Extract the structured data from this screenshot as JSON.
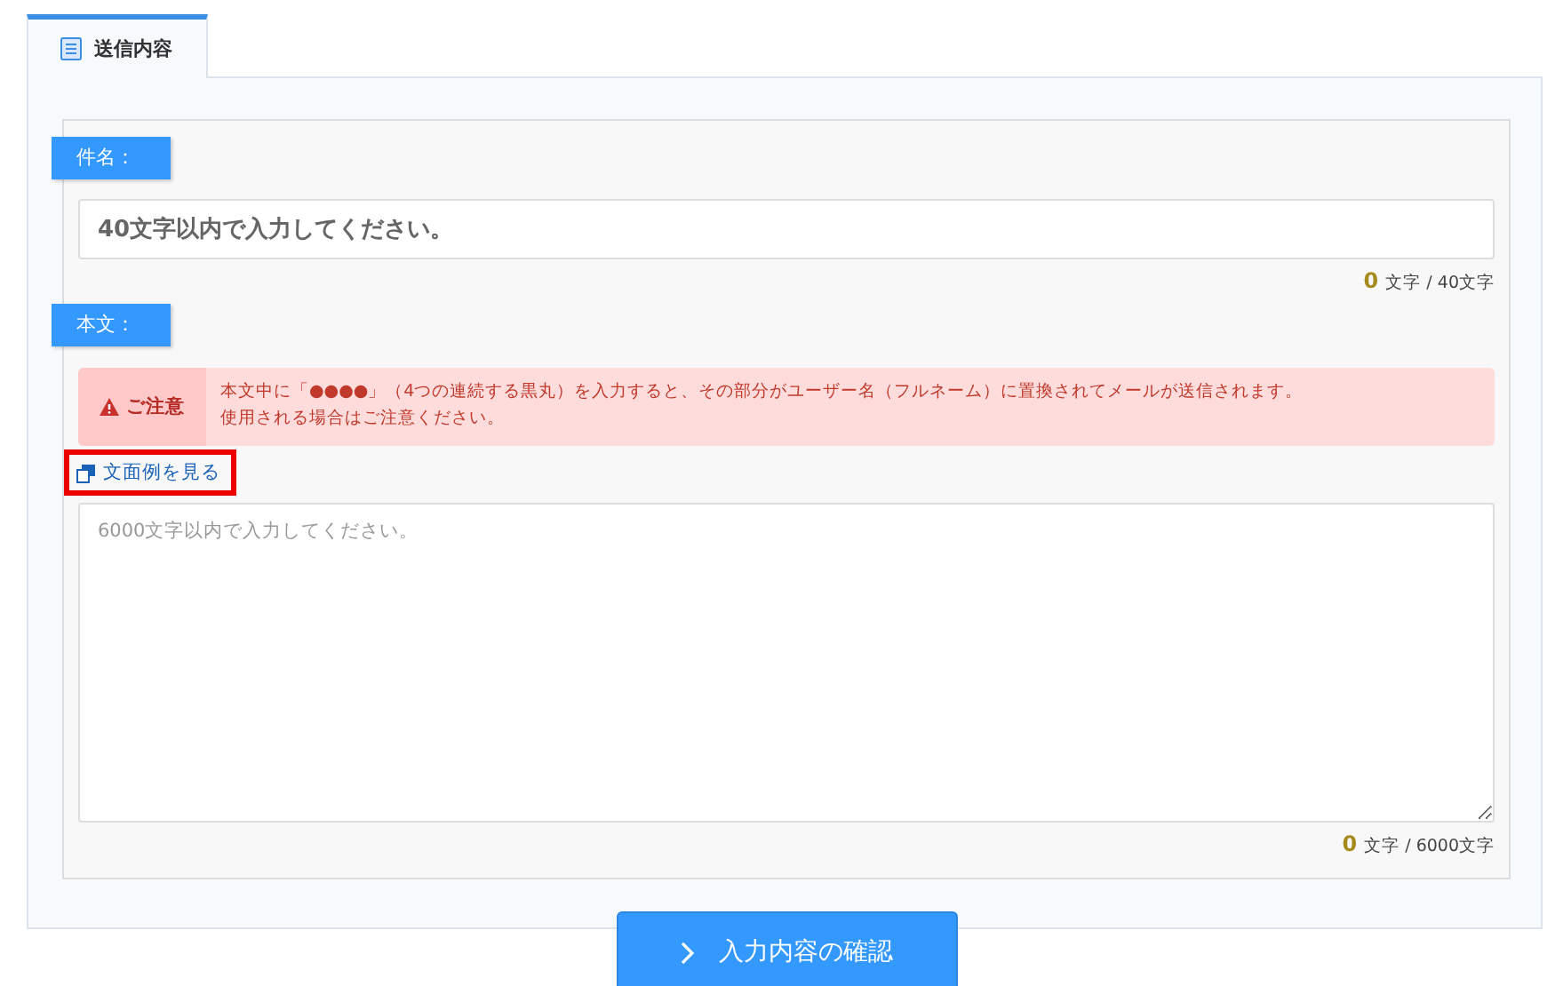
{
  "tabs": [
    {
      "label": "送信内容",
      "selected": true
    }
  ],
  "subject": {
    "label": "件名：",
    "placeholder": "40文字以内で入力してください。",
    "count": "0",
    "limit": "文字 / 40文字"
  },
  "body": {
    "label": "本文：",
    "notice": {
      "title": "ご注意",
      "lines": [
        "本文中に「●●●●」（4つの連続する黒丸）を入力すると、その部分がユーザー名（フルネーム）に置換されてメールが送信されます。",
        "使用される場合はご注意ください。"
      ]
    },
    "example_link": {
      "label": "文面例を見る",
      "highlighted": true
    },
    "placeholder": "6000文字以内で入力してください。",
    "count": "0",
    "limit": "文字 / 6000文字"
  },
  "confirm_button": {
    "label": "入力内容の確認"
  }
}
